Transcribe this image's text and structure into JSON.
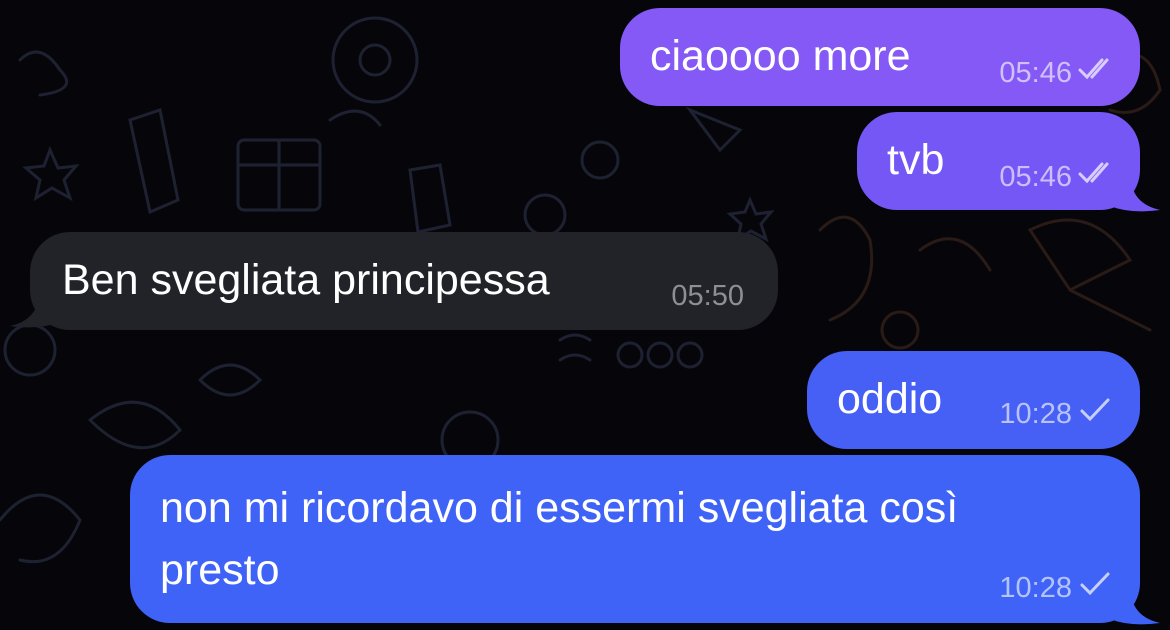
{
  "colors": {
    "outgoing_top": "#8a5cf6",
    "outgoing_bottom": "#3f64f5",
    "incoming": "#212328",
    "background": "#06060a"
  },
  "messages": [
    {
      "id": "m1",
      "direction": "outgoing",
      "text": "ciaoooo more",
      "time": "05:46",
      "status": "read",
      "status_icon": "double-check-icon"
    },
    {
      "id": "m2",
      "direction": "outgoing",
      "text": "tvb",
      "time": "05:46",
      "status": "read",
      "status_icon": "double-check-icon"
    },
    {
      "id": "m3",
      "direction": "incoming",
      "text": "Ben svegliata principessa",
      "time": "05:50"
    },
    {
      "id": "m4",
      "direction": "outgoing",
      "text": "oddio",
      "time": "10:28",
      "status": "sent",
      "status_icon": "single-check-icon"
    },
    {
      "id": "m5",
      "direction": "outgoing",
      "text_lines": [
        "non mi ricordavo di essermi svegliata così",
        "presto"
      ],
      "time": "10:28",
      "status": "sent",
      "status_icon": "single-check-icon"
    }
  ]
}
